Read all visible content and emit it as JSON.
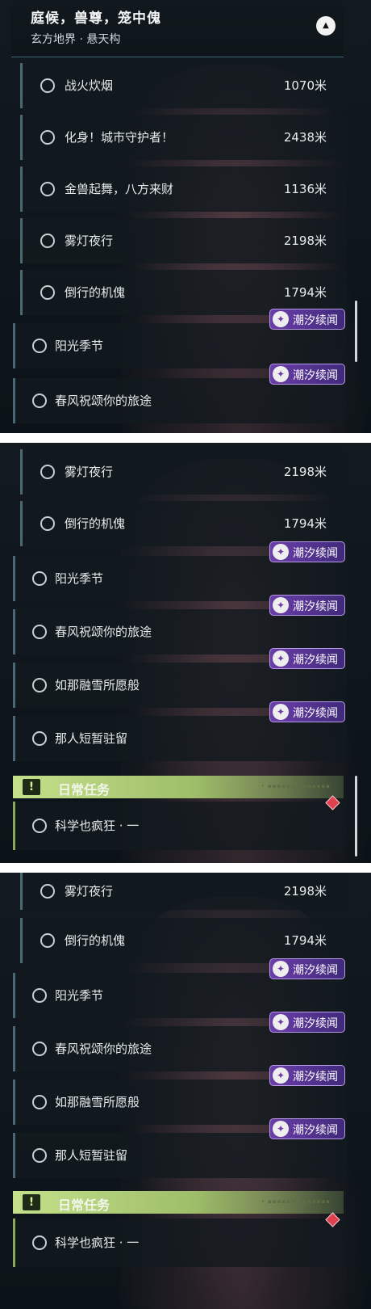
{
  "header": {
    "title": "庭候，兽尊，笼中傀",
    "subtitle": "玄方地界 · 悬天构",
    "toggle_icon": "chevron-up-icon"
  },
  "badge_label": "潮汐续闻",
  "daily": {
    "label": "日常任务",
    "task": "科学也疯狂 · 一"
  },
  "panel1": {
    "quests": [
      {
        "name": "战火炊烟",
        "distance": "1070米"
      },
      {
        "name": "化身！城市守护者！",
        "distance": "2438米"
      },
      {
        "name": "金兽起舞，八方来财",
        "distance": "1136米"
      },
      {
        "name": "雾灯夜行",
        "distance": "2198米"
      },
      {
        "name": "倒行的机傀",
        "distance": "1794米"
      }
    ],
    "events": [
      "阳光季节",
      "春风祝颂你的旅途"
    ]
  },
  "panel2": {
    "quests": [
      {
        "name": "雾灯夜行",
        "distance": "2198米"
      },
      {
        "name": "倒行的机傀",
        "distance": "1794米"
      }
    ],
    "events": [
      "阳光季节",
      "春风祝颂你的旅途",
      "如那融雪所愿般",
      "那人短暂驻留"
    ]
  },
  "panel3": {
    "quests": [
      {
        "name": "雾灯夜行",
        "distance": "2198米"
      },
      {
        "name": "倒行的机傀",
        "distance": "1794米"
      }
    ],
    "events": [
      "阳光季节",
      "春风祝颂你的旅途",
      "如那融雪所愿般",
      "那人短暂驻留"
    ]
  }
}
